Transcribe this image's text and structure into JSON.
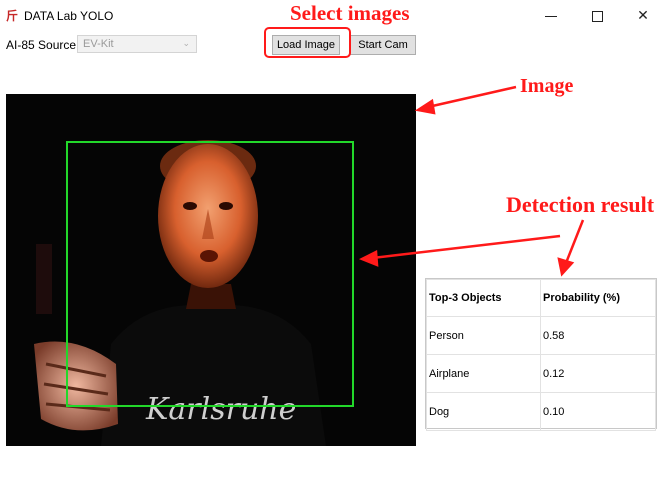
{
  "window": {
    "title": "DATA Lab YOLO",
    "icon": "app-logo-icon"
  },
  "toolbar": {
    "source_label": "AI-85 Source:",
    "source_value": "EV-Kit",
    "load_button": "Load Image",
    "cam_button": "Start Cam"
  },
  "annotations": {
    "select": "Select images",
    "image": "Image",
    "detection": "Detection result",
    "color": "#ff1a1a"
  },
  "image_panel": {
    "shirt_text": "Karlsruhe",
    "box_color": "#22d82a"
  },
  "results": {
    "headers": [
      "Top-3 Objects",
      "Probability (%)"
    ],
    "rows": [
      {
        "object": "Person",
        "prob": "0.58"
      },
      {
        "object": "Airplane",
        "prob": "0.12"
      },
      {
        "object": "Dog",
        "prob": "0.10"
      }
    ]
  }
}
